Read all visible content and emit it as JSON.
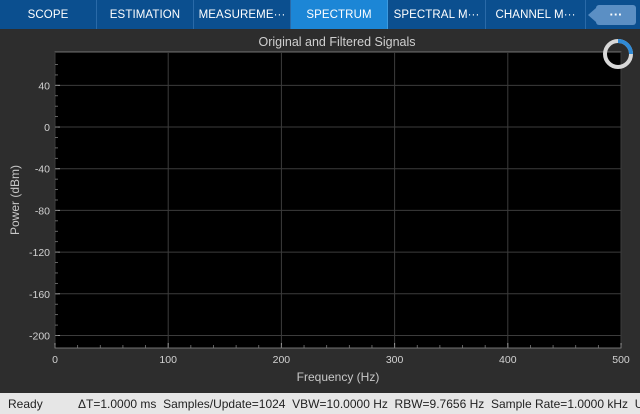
{
  "tabs": [
    {
      "label": "SCOPE",
      "active": false
    },
    {
      "label": "ESTIMATION",
      "active": false
    },
    {
      "label": "MEASUREME···",
      "active": false
    },
    {
      "label": "SPECTRUM",
      "active": true
    },
    {
      "label": "SPECTRAL M···",
      "active": false
    },
    {
      "label": "CHANNEL M···",
      "active": false
    }
  ],
  "more_button_label": "···",
  "colors": {
    "tab_bar": "#0b4f8f",
    "tab_active": "#1c86d6",
    "plot_bg": "#000000",
    "frame_bg": "#2d2d2d",
    "grid": "#3c3c3c",
    "status_bg": "#e6e6e6"
  },
  "chart_data": {
    "type": "line",
    "title": "Original and Filtered Signals",
    "xlabel": "Frequency (Hz)",
    "ylabel": "Power (dBm)",
    "xlim": [
      0,
      500
    ],
    "ylim": [
      -212,
      72
    ],
    "x_ticks": [
      0,
      100,
      200,
      300,
      400,
      500
    ],
    "y_ticks": [
      40,
      0,
      -40,
      -80,
      -120,
      -160,
      -200
    ],
    "grid": true,
    "series": []
  },
  "status": {
    "state": "Ready",
    "delta_t": "ΔT=1.0000 ms",
    "samples_per_update": "Samples/Update=1024",
    "vbw": "VBW=10.0000 Hz",
    "rbw": "RBW=9.7656 Hz",
    "sample_rate": "Sample Rate=1.0000 kHz",
    "trailing": "U"
  }
}
